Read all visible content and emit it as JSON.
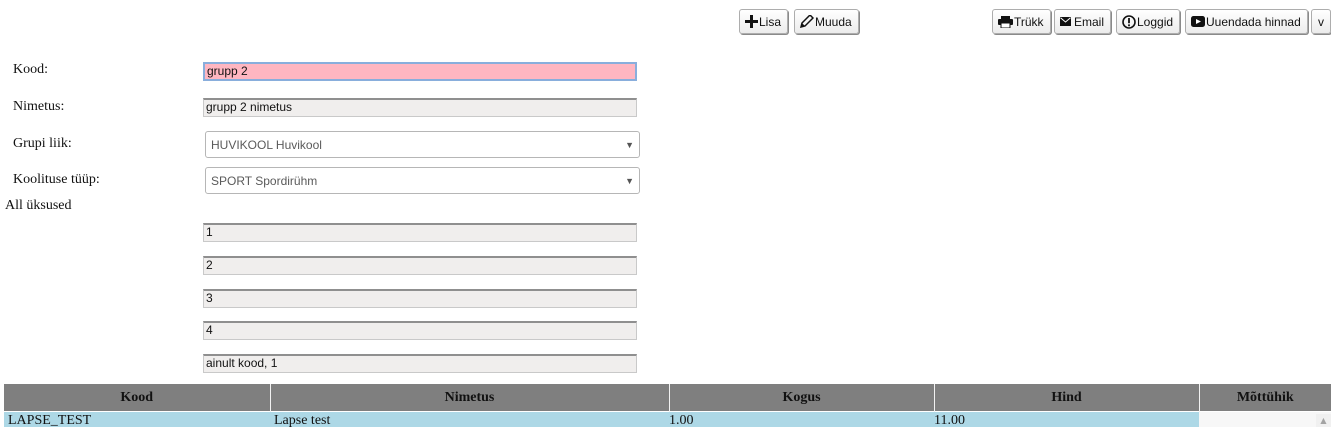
{
  "toolbar": {
    "add_label": "Lisa",
    "edit_label": "Muuda",
    "print_label": "Trükk",
    "email_label": "Email",
    "logs_label": "Loggid",
    "update_prices_label": "Uuendada hinnad",
    "more_label": "v"
  },
  "form": {
    "code_label": "Kood:",
    "code_value": "grupp 2",
    "name_label": "Nimetus:",
    "name_value": "grupp 2 nimetus",
    "group_type_label": "Grupi liik:",
    "group_type_value": "HUVIKOOL Huvikool",
    "training_type_label": "Koolituse tüüp:",
    "training_type_value": "SPORT Spordirühm",
    "all_units_label": "All üksused",
    "units": [
      "1",
      "2",
      "3",
      "4",
      "ainult kood, 1"
    ]
  },
  "grid": {
    "columns": [
      "Kood",
      "Nimetus",
      "Kogus",
      "Hind",
      "Mõttühik"
    ],
    "rows": [
      [
        "LAPSE_TEST",
        "Lapse test",
        "1.00",
        "11.00",
        ""
      ]
    ]
  },
  "colors": {
    "focused_field": "#ffb6c1",
    "header_bg": "#7f7f7f",
    "selected_row": "#add8e6"
  },
  "icons": {
    "add": "plus-icon",
    "edit": "pencil-icon",
    "print": "printer-icon",
    "email": "envelope-icon",
    "logs": "exclamation-circle-icon",
    "update": "play-icon",
    "scroll": "scroll-up-arrow-icon"
  }
}
